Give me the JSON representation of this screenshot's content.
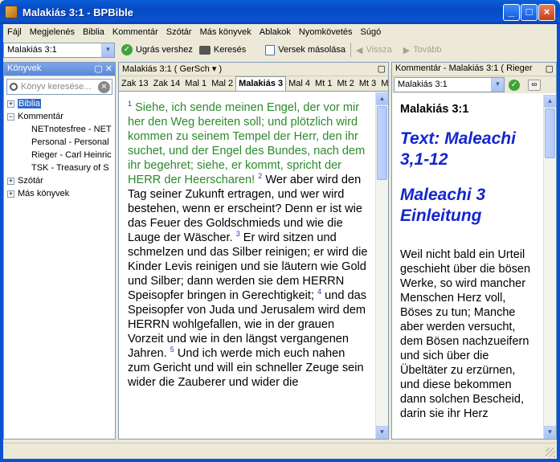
{
  "window": {
    "title": "Malakiás 3:1 - BPBible"
  },
  "menu": [
    "Fájl",
    "Megjelenés",
    "Biblia",
    "Kommentár",
    "Szótár",
    "Más könyvek",
    "Ablakok",
    "Nyomkövetés",
    "Súgó"
  ],
  "toolbar": {
    "reference": "Malakiás 3:1",
    "goto_label": "Ugrás vershez",
    "search_label": "Keresés",
    "copy_label": "Versek másolása",
    "back_label": "Vissza",
    "forward_label": "Tovább"
  },
  "books_pane": {
    "title": "Könyvek",
    "search_placeholder": "Könyv keresése...",
    "tree": {
      "bible": "Biblia",
      "commentary": "Kommentár",
      "commentaries": [
        "NETnotesfree - NET",
        "Personal - Personal",
        "Rieger - Carl Heinric",
        "TSK - Treasury of S"
      ],
      "dictionary": "Szótár",
      "other": "Más könyvek"
    }
  },
  "bible_pane": {
    "header": "Malakiás 3:1 ( GerSch ▾ )",
    "tabs": [
      "Zak 13",
      "Zak 14",
      "Mal 1",
      "Mal 2",
      "Malakiás 3",
      "Mal 4",
      "Mt 1",
      "Mt 2",
      "Mt 3",
      "Mt 4"
    ],
    "active_tab": "Malakiás 3",
    "verses": [
      {
        "n": "1",
        "text": "Siehe, ich sende meinen Engel, der vor mir her den Weg bereiten soll; und plötzlich wird kommen zu seinem Tempel der Herr, den ihr suchet, und der Engel des Bundes, nach dem ihr begehret; siehe, er kommt, spricht der HERR der Heerscharen!",
        "highlight": true
      },
      {
        "n": "2",
        "text": "Wer aber wird den Tag seiner Zukunft ertragen, und wer wird bestehen, wenn er erscheint? Denn er ist wie das Feuer des Goldschmieds und wie die Lauge der Wäscher.",
        "highlight": false
      },
      {
        "n": "3",
        "text": "Er wird sitzen und schmelzen und das Silber reinigen; er wird die Kinder Levis reinigen und sie läutern wie Gold und Silber; dann werden sie dem HERRN Speisopfer bringen in Gerechtigkeit;",
        "highlight": false
      },
      {
        "n": "4",
        "text": "und das Speisopfer von Juda und Jerusalem wird dem HERRN wohlgefallen, wie in der grauen Vorzeit und wie in den längst vergangenen Jahren.",
        "highlight": false
      },
      {
        "n": "5",
        "text": "Und ich werde mich euch nahen zum Gericht und will ein schneller Zeuge sein wider die Zauberer und wider die",
        "highlight": false
      }
    ]
  },
  "commentary_pane": {
    "header": "Kommentár - Malakiás 3:1 ( Rieger",
    "reference": "Malakiás 3:1",
    "ref_heading": "Malakiás 3:1",
    "heading1": "Text: Maleachi 3,1-12",
    "heading2": "Maleachi 3 Einleitung",
    "body": "Weil nicht bald ein Urteil geschieht über die bösen Werke, so wird mancher Menschen Herz voll, Böses zu tun; Manche aber werden versucht, dem Bösen nachzueifern und sich über die Übeltäter zu erzürnen, und diese bekommen dann solchen Bescheid, darin sie ihr Herz"
  },
  "colors": {
    "accent": "#316ac5",
    "verse_highlight": "#2c8a2c",
    "heading_blue": "#1426cc",
    "verse_number": "#1a40c8"
  }
}
